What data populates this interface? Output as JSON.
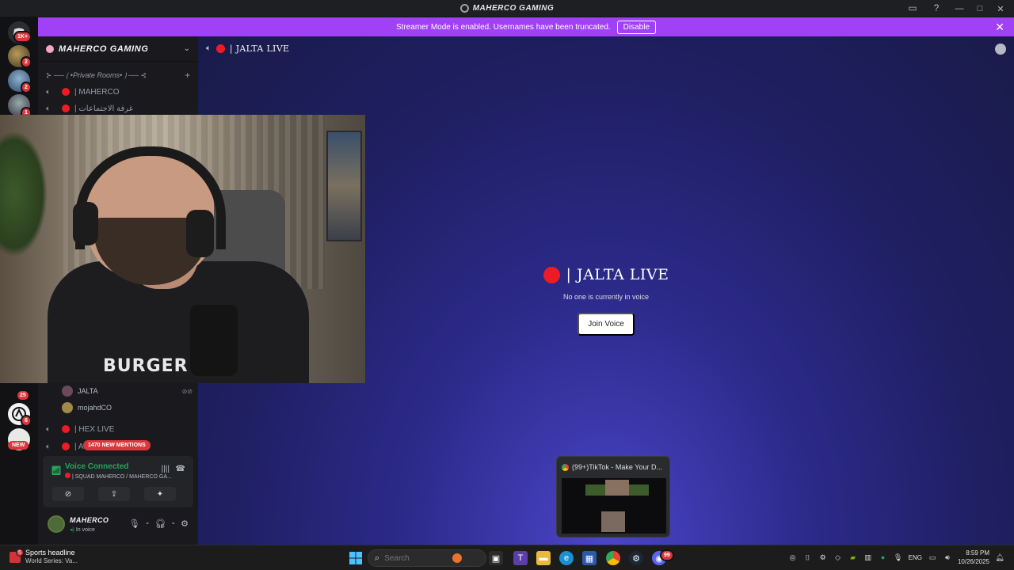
{
  "window": {
    "title": "MAHERCO GAMING"
  },
  "banner": {
    "message": "Streamer Mode is enabled. Usernames have been truncated.",
    "disable_label": "Disable"
  },
  "rail": {
    "home_badge": "1K+",
    "servers": [
      {
        "badge": "2"
      },
      {
        "badge": "2"
      },
      {
        "badge": "1"
      },
      {
        "badge": "25"
      },
      {
        "badge": "6"
      }
    ],
    "new_label": "NEW"
  },
  "sidebar": {
    "server_name": "MAHERCO GAMING",
    "category": "⊱ ── ⟮ •Private Rooms• ⟯ ── ⊰",
    "channels": [
      {
        "name": "| MAHERCO"
      },
      {
        "name": "| غرفة الاجتماعات"
      },
      {
        "name": "| HEX LIVE"
      },
      {
        "name": "| A"
      }
    ],
    "members": [
      {
        "name": "JALTA"
      },
      {
        "name": "mojahdCO"
      }
    ],
    "mentions_label": "1470 NEW MENTIONS"
  },
  "voice_panel": {
    "status": "Voice Connected",
    "channel": "| SQUAD MAHERCO / MAHERCO GA..."
  },
  "user_panel": {
    "username": "MAHERCO",
    "status": "In voice"
  },
  "main": {
    "channel_title": "| JALTA LIVE",
    "stage_title": "| JALTA LIVE",
    "stage_subtitle": "No one is currently in voice",
    "join_label": "Join Voice"
  },
  "webcam": {
    "shirt_text": "BURGER"
  },
  "thumbnail": {
    "title": "(99+)TikTok - Make Your D..."
  },
  "taskbar": {
    "news_title": "Sports headline",
    "news_sub": "World Series: Va...",
    "news_badge": "5",
    "search_placeholder": "Search",
    "language": "ENG",
    "time": "8:59 PM",
    "date": "10/26/2025",
    "discord_badge": "99"
  },
  "colors": {
    "streamer_banner": "#a041f5",
    "live_dot": "#ed1c24",
    "voice_connected": "#23a55a",
    "badge_red": "#da373c"
  }
}
